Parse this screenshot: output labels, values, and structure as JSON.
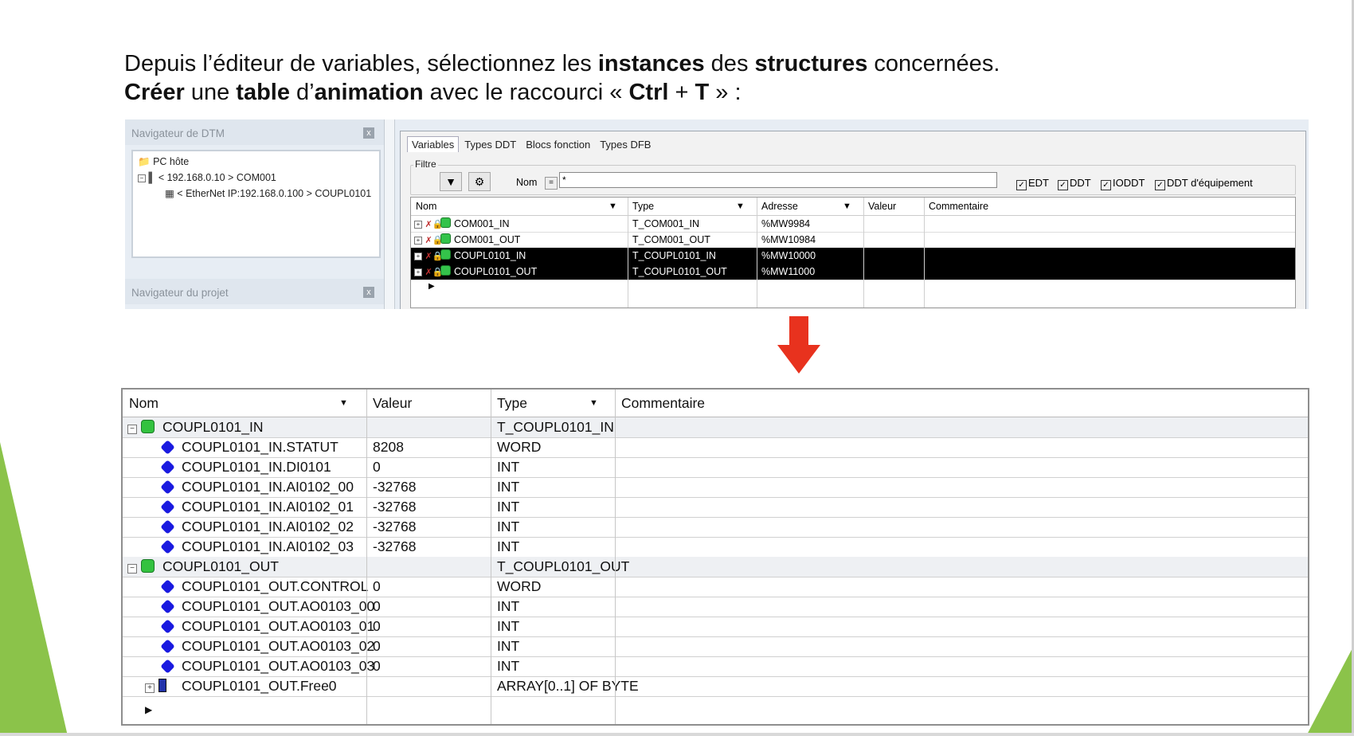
{
  "slide": {
    "line1": [
      {
        "t": "Depuis l’éditeur de variables, sélectionnez les ",
        "b": false
      },
      {
        "t": "instances",
        "b": true
      },
      {
        "t": " des ",
        "b": false
      },
      {
        "t": "structures",
        "b": true
      },
      {
        "t": " concernées.",
        "b": false
      }
    ],
    "line2": [
      {
        "t": "Créer",
        "b": true
      },
      {
        "t": " une ",
        "b": false
      },
      {
        "t": "table",
        "b": true
      },
      {
        "t": " d’",
        "b": false
      },
      {
        "t": "animation",
        "b": true
      },
      {
        "t": " avec le raccourci « ",
        "b": false
      },
      {
        "t": "Ctrl",
        "b": true
      },
      {
        "t": " + ",
        "b": false
      },
      {
        "t": "T",
        "b": true
      },
      {
        "t": " » :",
        "b": false
      }
    ]
  },
  "dtm": {
    "title": "Navigateur de DTM",
    "close": "x",
    "host": "PC hôte",
    "node1": "< 192.168.0.10 > COM001",
    "node2": "< EtherNet IP:192.168.0.100 > COUPL0101",
    "project_title": "Navigateur du projet"
  },
  "editor": {
    "tabs": [
      "Variables",
      "Types DDT",
      "Blocs fonction",
      "Types DFB"
    ],
    "filtre": "Filtre",
    "nom_label": "Nom",
    "eq": "=",
    "filter_value": "*",
    "checks": [
      "EDT",
      "DDT",
      "IODDT",
      "DDT d'équipement"
    ],
    "headers": {
      "nom": "Nom",
      "type": "Type",
      "adresse": "Adresse",
      "valeur": "Valeur",
      "commentaire": "Commentaire"
    },
    "rows": [
      {
        "nom": "COM001_IN",
        "type": "T_COM001_IN",
        "adresse": "%MW9984"
      },
      {
        "nom": "COM001_OUT",
        "type": "T_COM001_OUT",
        "adresse": "%MW10984"
      },
      {
        "nom": "COUPL0101_IN",
        "type": "T_COUPL0101_IN",
        "adresse": "%MW10000"
      },
      {
        "nom": "COUPL0101_OUT",
        "type": "T_COUPL0101_OUT",
        "adresse": "%MW11000"
      }
    ]
  },
  "anim": {
    "headers": {
      "nom": "Nom",
      "valeur": "Valeur",
      "type": "Type",
      "commentaire": "Commentaire"
    },
    "rows": [
      {
        "nom": "COUPL0101_IN",
        "valeur": "",
        "type": "T_COUPL0101_IN"
      },
      {
        "nom": "COUPL0101_IN.STATUT",
        "valeur": "8208",
        "type": "WORD"
      },
      {
        "nom": "COUPL0101_IN.DI0101",
        "valeur": "0",
        "type": "INT"
      },
      {
        "nom": "COUPL0101_IN.AI0102_00",
        "valeur": "-32768",
        "type": "INT"
      },
      {
        "nom": "COUPL0101_IN.AI0102_01",
        "valeur": "-32768",
        "type": "INT"
      },
      {
        "nom": "COUPL0101_IN.AI0102_02",
        "valeur": "-32768",
        "type": "INT"
      },
      {
        "nom": "COUPL0101_IN.AI0102_03",
        "valeur": "-32768",
        "type": "INT"
      },
      {
        "nom": "COUPL0101_OUT",
        "valeur": "",
        "type": "T_COUPL0101_OUT"
      },
      {
        "nom": "COUPL0101_OUT.CONTROL",
        "valeur": "0",
        "type": "WORD"
      },
      {
        "nom": "COUPL0101_OUT.AO0103_00",
        "valeur": "0",
        "type": "INT"
      },
      {
        "nom": "COUPL0101_OUT.AO0103_01",
        "valeur": "0",
        "type": "INT"
      },
      {
        "nom": "COUPL0101_OUT.AO0103_02",
        "valeur": "0",
        "type": "INT"
      },
      {
        "nom": "COUPL0101_OUT.AO0103_03",
        "valeur": "0",
        "type": "INT"
      },
      {
        "nom": "COUPL0101_OUT.Free0",
        "valeur": "",
        "type": "ARRAY[0..1] OF BYTE"
      }
    ]
  },
  "colors": {
    "accent_green": "#8bc34a",
    "arrow_red": "#e8321e",
    "selection": "#000000"
  }
}
